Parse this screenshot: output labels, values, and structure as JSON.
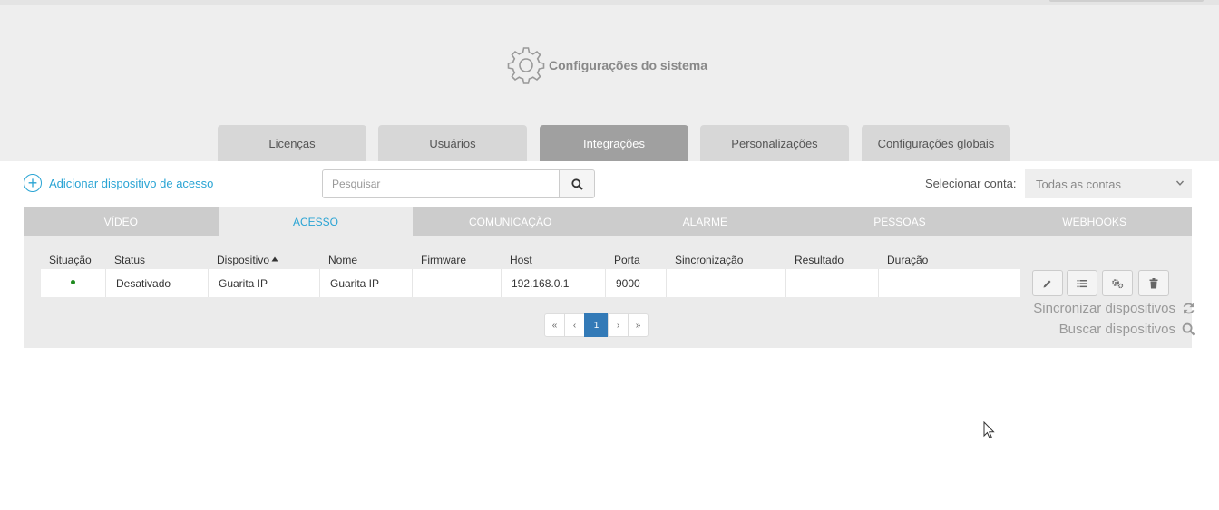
{
  "header": {
    "title": "Configurações do sistema",
    "icon": "gear-icon"
  },
  "main_tabs": [
    {
      "label": "Licenças",
      "active": false
    },
    {
      "label": "Usuários",
      "active": false
    },
    {
      "label": "Integrações",
      "active": true
    },
    {
      "label": "Personalizações",
      "active": false
    },
    {
      "label": "Configurações globais",
      "active": false
    }
  ],
  "toolbar": {
    "add_label": "Adicionar dispositivo de acesso",
    "search_placeholder": "Pesquisar",
    "account_label": "Selecionar conta:",
    "account_value": "Todas as contas"
  },
  "sub_tabs": [
    {
      "label": "VÍDEO",
      "active": false
    },
    {
      "label": "ACESSO",
      "active": true
    },
    {
      "label": "COMUNICAÇÃO",
      "active": false
    },
    {
      "label": "ALARME",
      "active": false
    },
    {
      "label": "PESSOAS",
      "active": false
    },
    {
      "label": "WEBHOOKS",
      "active": false
    }
  ],
  "table": {
    "columns": [
      "Situação",
      "Status",
      "Dispositivo",
      "Nome",
      "Firmware",
      "Host",
      "Porta",
      "Sincronização",
      "Resultado",
      "Duração"
    ],
    "sorted_column": "Dispositivo",
    "rows": [
      {
        "situacao": "active",
        "status": "Desativado",
        "dispositivo": "Guarita IP",
        "nome": "Guarita IP",
        "firmware": "",
        "host": "192.168.0.1",
        "porta": "9000",
        "sincronizacao": "",
        "resultado": "",
        "duracao": ""
      }
    ],
    "row_actions": [
      "pencil-icon",
      "list-icon",
      "cogs-icon",
      "trash-icon"
    ]
  },
  "pagination": {
    "first": "«",
    "prev": "‹",
    "current": "1",
    "next": "›",
    "last": "»"
  },
  "side_actions": {
    "sync_label": "Sincronizar dispositivos",
    "search_label": "Buscar dispositivos"
  },
  "colors": {
    "accent": "#2aa4d4",
    "active_main_tab": "#a0a0a0",
    "pager_active": "#337ab7",
    "status_dot": "#1e8a1e"
  }
}
